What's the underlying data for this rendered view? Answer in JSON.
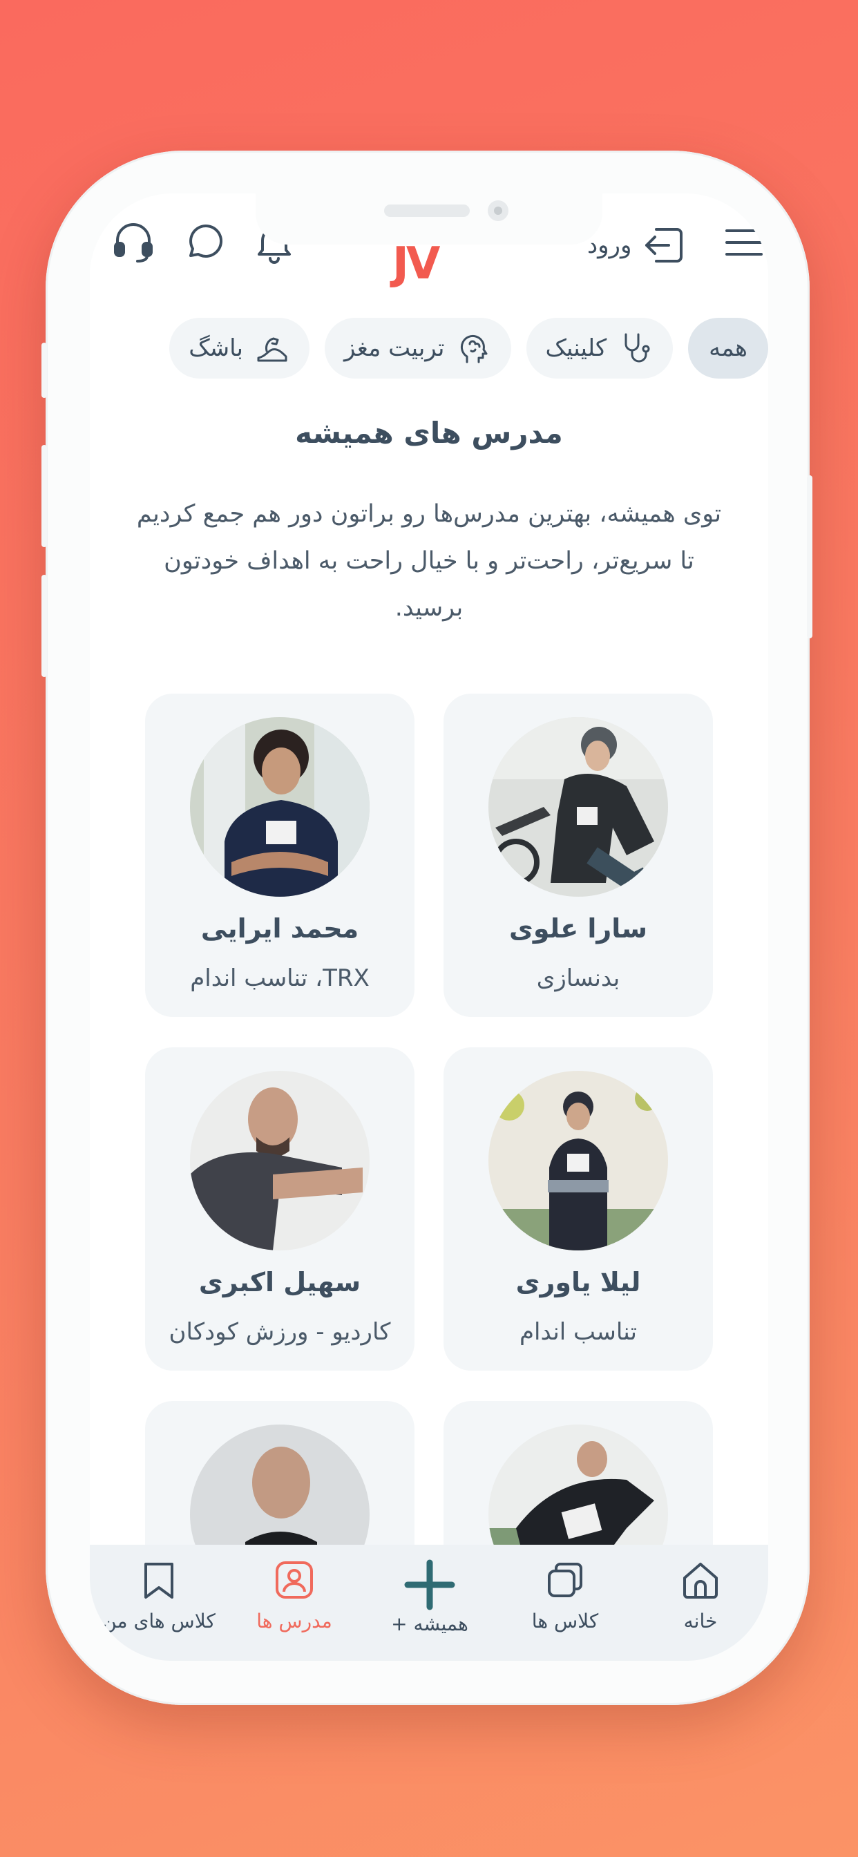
{
  "header": {
    "login_label": "ورود",
    "logo_text": "JV",
    "icons": [
      "menu-icon",
      "login-icon",
      "bell-icon",
      "chat-icon",
      "headset-icon"
    ]
  },
  "categories": [
    {
      "label": "همه",
      "icon": null,
      "active": true
    },
    {
      "label": "کلینیک",
      "icon": "stethoscope-icon",
      "active": false
    },
    {
      "label": "تربیت مغز",
      "icon": "brain-icon",
      "active": false
    },
    {
      "label": "باشگ",
      "icon": "muscle-icon",
      "active": false
    }
  ],
  "section": {
    "title": "مدرس های همیشه",
    "description": "توی همیشه، بهترین مدرس‌ها رو براتون دور هم جمع کردیم تا سریع‌تر، راحت‌تر و با خیال راحت به اهداف خودتون برسید."
  },
  "instructors": [
    {
      "name": "سارا علوی",
      "specialty": "بدنسازی"
    },
    {
      "name": "محمد ایرایی",
      "specialty": "TRX، تناسب اندام"
    },
    {
      "name": "لیلا یاوری",
      "specialty": "تناسب اندام"
    },
    {
      "name": "سهیل اکبری",
      "specialty": "کاردیو - ورزش کودکان"
    },
    {
      "name": "",
      "specialty": ""
    },
    {
      "name": "",
      "specialty": ""
    }
  ],
  "bottom_nav": {
    "home": "خانه",
    "classes": "کلاس ها",
    "hamishe_plus": "همیشه +",
    "instructors": "مدرس ها",
    "my_classes": "کلاس های من"
  },
  "colors": {
    "accent": "#f06a5c",
    "text": "#3d4e5f",
    "teal": "#2f6b73",
    "background_gradient": [
      "#fa6a5e",
      "#fb9366"
    ]
  }
}
